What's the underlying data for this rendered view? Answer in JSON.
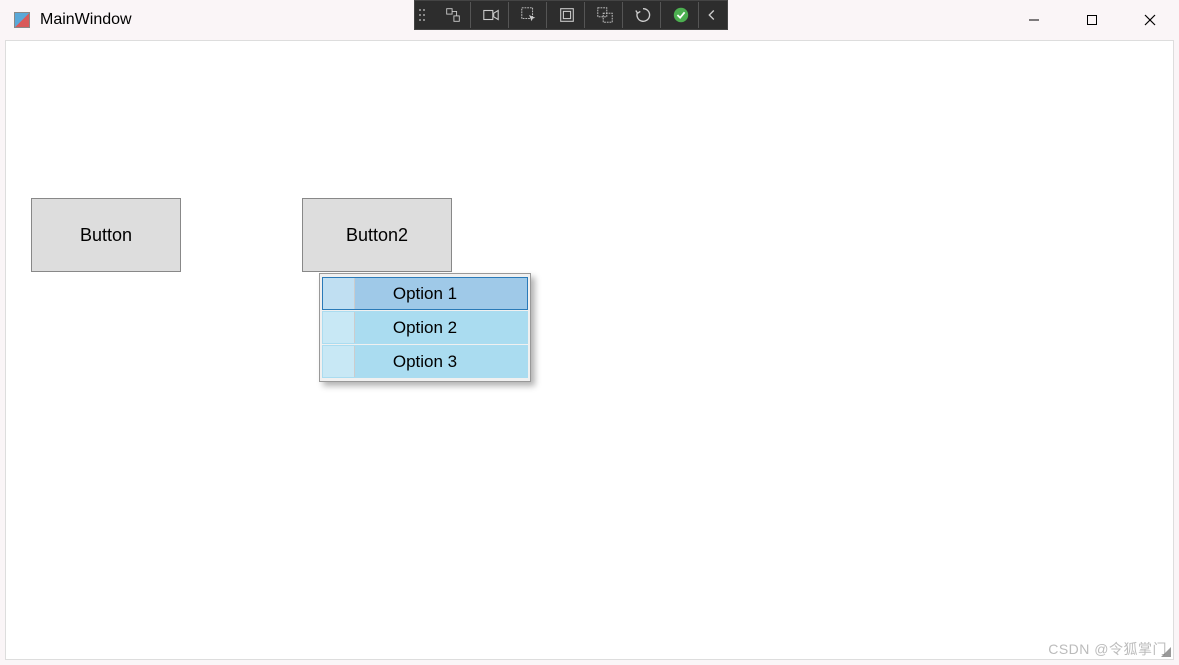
{
  "window": {
    "title": "MainWindow"
  },
  "buttons": {
    "button1_label": "Button",
    "button2_label": "Button2"
  },
  "context_menu": {
    "items": [
      {
        "label": "Option 1"
      },
      {
        "label": "Option 2"
      },
      {
        "label": "Option 3"
      }
    ]
  },
  "watermark": "CSDN @令狐掌门"
}
